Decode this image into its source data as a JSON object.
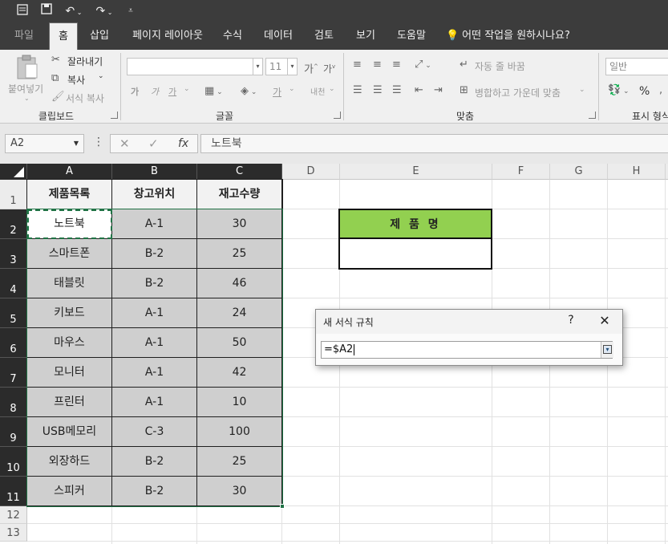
{
  "quick_access": {
    "save_icon": "save-icon",
    "undo_icon": "undo-icon",
    "redo_icon": "redo-icon",
    "customize_icon": "customize-toolbar-icon"
  },
  "tabs": {
    "file": "파일",
    "home": "홈",
    "insert": "삽입",
    "page_layout": "페이지 레이아웃",
    "formulas": "수식",
    "data": "데이터",
    "review": "검토",
    "view": "보기",
    "help": "도움말",
    "tell_me": "어떤 작업을 원하시나요?"
  },
  "ribbon": {
    "clipboard": {
      "paste": "붙여넣기",
      "cut": "잘라내기",
      "copy": "복사",
      "format_painter": "서식 복사",
      "group": "클립보드"
    },
    "font": {
      "font_name": "",
      "font_size": "11",
      "bold": "가",
      "italic": "가",
      "underline": "가",
      "font_color": "가",
      "phonetic": "내천",
      "group": "글꼴"
    },
    "alignment": {
      "wrap_text": "자동 줄 바꿈",
      "merge_center": "병합하고 가운데 맞춤",
      "group": "맞춤"
    },
    "number": {
      "format": "일반",
      "percent": "%",
      "group": "표시 형식"
    }
  },
  "formula_bar": {
    "name_box": "A2",
    "fx": "fx",
    "formula": "노트북"
  },
  "columns": [
    "A",
    "B",
    "C",
    "D",
    "E",
    "F",
    "G",
    "H"
  ],
  "rows": [
    "1",
    "2",
    "3",
    "4",
    "5",
    "6",
    "7",
    "8",
    "9",
    "10",
    "11",
    "12",
    "13"
  ],
  "table": {
    "headers": [
      "제품목록",
      "창고위치",
      "재고수량"
    ],
    "rows": [
      [
        "노트북",
        "A-1",
        "30"
      ],
      [
        "스마트폰",
        "B-2",
        "25"
      ],
      [
        "태블릿",
        "B-2",
        "46"
      ],
      [
        "키보드",
        "A-1",
        "24"
      ],
      [
        "마우스",
        "A-1",
        "50"
      ],
      [
        "모니터",
        "A-1",
        "42"
      ],
      [
        "프린터",
        "A-1",
        "10"
      ],
      [
        "USB메모리",
        "C-3",
        "100"
      ],
      [
        "외장하드",
        "B-2",
        "25"
      ],
      [
        "스피커",
        "B-2",
        "30"
      ]
    ]
  },
  "lookup": {
    "header": "제 품 명",
    "value": ""
  },
  "dialog": {
    "title": "새 서식 규칙",
    "help": "?",
    "close": "✕",
    "input_value": "=$A2"
  },
  "colors": {
    "accent_green": "#217346",
    "header_green": "#92d050",
    "selection_gray": "#cfcfcf"
  }
}
